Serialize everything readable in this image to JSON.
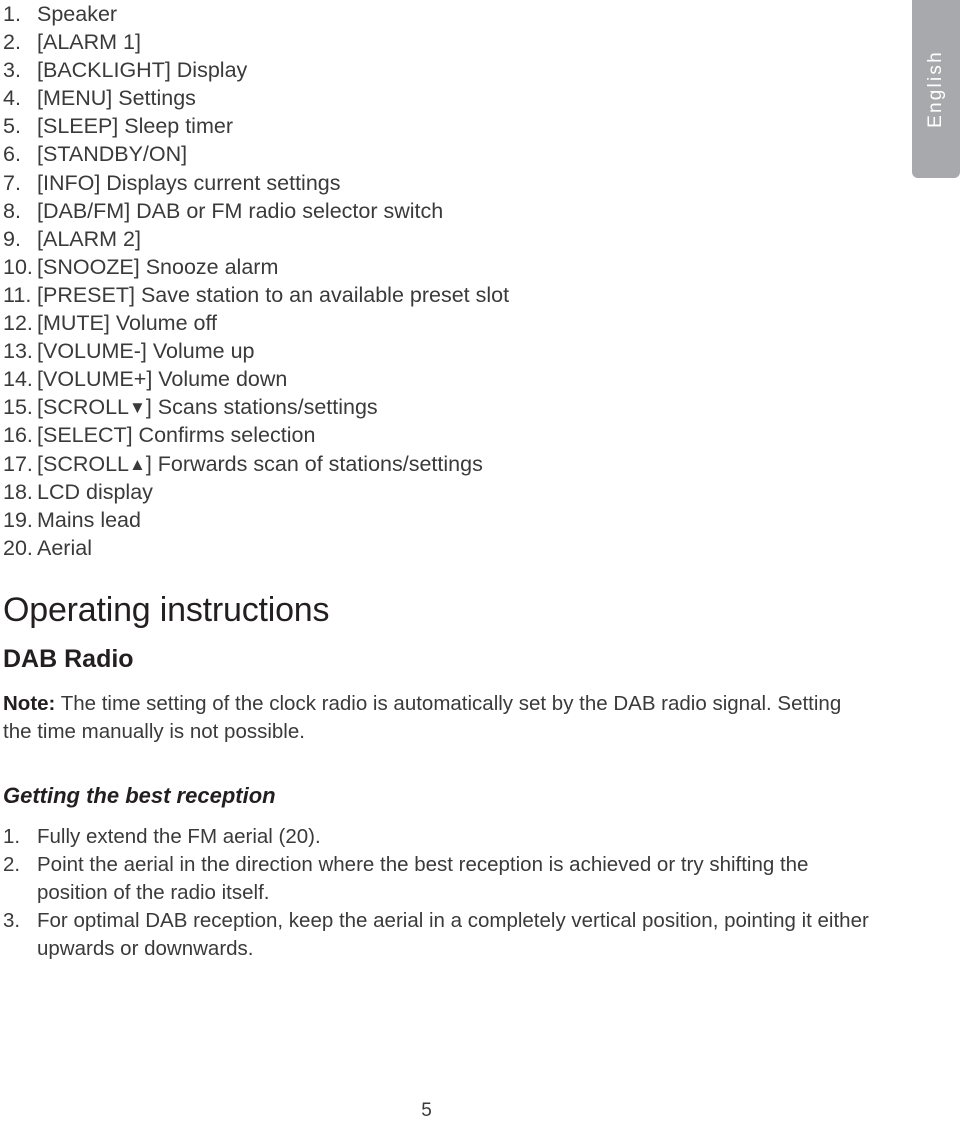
{
  "language_tab": {
    "label": "English"
  },
  "parts_list": [
    {
      "num": "1.",
      "text": "Speaker"
    },
    {
      "num": "2.",
      "text": "[ALARM 1]"
    },
    {
      "num": "3.",
      "text": "[BACKLIGHT] Display"
    },
    {
      "num": "4.",
      "text": "[MENU] Settings"
    },
    {
      "num": "5.",
      "text": "[SLEEP] Sleep timer"
    },
    {
      "num": "6.",
      "text": "[STANDBY/ON]"
    },
    {
      "num": "7.",
      "text": "[INFO] Displays current settings"
    },
    {
      "num": "8.",
      "text": "[DAB/FM] DAB or FM radio selector switch"
    },
    {
      "num": "9.",
      "text": "[ALARM 2]"
    },
    {
      "num": "10.",
      "text": "[SNOOZE] Snooze alarm"
    },
    {
      "num": "11.",
      "text": "[PRESET] Save station to an available preset slot"
    },
    {
      "num": "12.",
      "text": "[MUTE] Volume off"
    },
    {
      "num": "13.",
      "text": "[VOLUME-] Volume up"
    },
    {
      "num": "14.",
      "text": "[VOLUME+] Volume down"
    },
    {
      "num": "15.",
      "text": "[SCROLL▼] Scans stations/settings"
    },
    {
      "num": "16.",
      "text": "[SELECT] Confirms selection"
    },
    {
      "num": "17.",
      "text": "[SCROLL▲] Forwards scan of stations/settings"
    },
    {
      "num": "18.",
      "text": "LCD display"
    },
    {
      "num": "19.",
      "text": "Mains lead"
    },
    {
      "num": "20.",
      "text": "Aerial"
    }
  ],
  "main_title": "Operating instructions",
  "sub_title": "DAB Radio",
  "note": {
    "label": "Note:",
    "body": " The time setting of the clock radio is automatically set by the DAB radio signal. Setting the time manually is not possible."
  },
  "section_title": "Getting the best reception",
  "steps": [
    {
      "num": "1.",
      "text": "Fully extend the FM aerial (20)."
    },
    {
      "num": "2.",
      "text": "Point the aerial in the direction where the best reception is achieved or try shifting the position of the radio itself."
    },
    {
      "num": "3.",
      "text": "For optimal DAB reception, keep the aerial in a completely vertical position, pointing it either upwards or downwards."
    }
  ],
  "page_number": "5",
  "colors": {
    "tab_background": "#a7a9ac",
    "tab_text": "#ffffff",
    "body_text": "#3a3a3a",
    "heading_text": "#231f20",
    "page_background": "#ffffff"
  }
}
